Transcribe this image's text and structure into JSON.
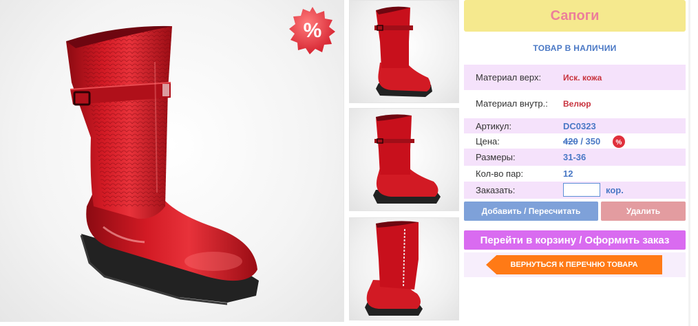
{
  "product": {
    "title": "Сапоги",
    "stock_status": "ТОВАР В НАЛИЧИИ",
    "images": [
      "red-boot-main",
      "red-boot-front",
      "red-boot-side",
      "red-boot-inner"
    ]
  },
  "badge": {
    "sale_symbol": "%"
  },
  "specs": {
    "material_top_label": "Материал верх:",
    "material_top_value": "Иск. кожа",
    "material_inner_label": "Материал внутр.:",
    "material_inner_value": "Велюр",
    "article_label": "Артикул:",
    "article_value": "DC0323",
    "price_label": "Цена:",
    "price_old": "420",
    "price_sep": " / ",
    "price_new": "350",
    "sizes_label": "Размеры:",
    "sizes_value": "31-36",
    "pairs_label": "Кол-во пар:",
    "pairs_value": "12",
    "order_label": "Заказать:",
    "order_value": "",
    "order_unit": "кор."
  },
  "buttons": {
    "add_label": "Добавить / Пересчитать",
    "delete_label": "Удалить",
    "cart_label": "Перейти в корзину / Оформить заказ",
    "back_label": "ВЕРНУТЬСЯ К ПЕРЕЧНЮ ТОВАРА"
  },
  "colors": {
    "title_bg": "#f5e98e",
    "title_text": "#ec7e9b",
    "accent_blue": "#4a78c5",
    "accent_red": "#c8333e",
    "row_pink": "#f5e2fb",
    "btn_add": "#7ea1d9",
    "btn_delete": "#e39ca0",
    "btn_cart": "#d96bf0",
    "btn_back": "#ff7a16",
    "boot_red": "#c8101c"
  }
}
